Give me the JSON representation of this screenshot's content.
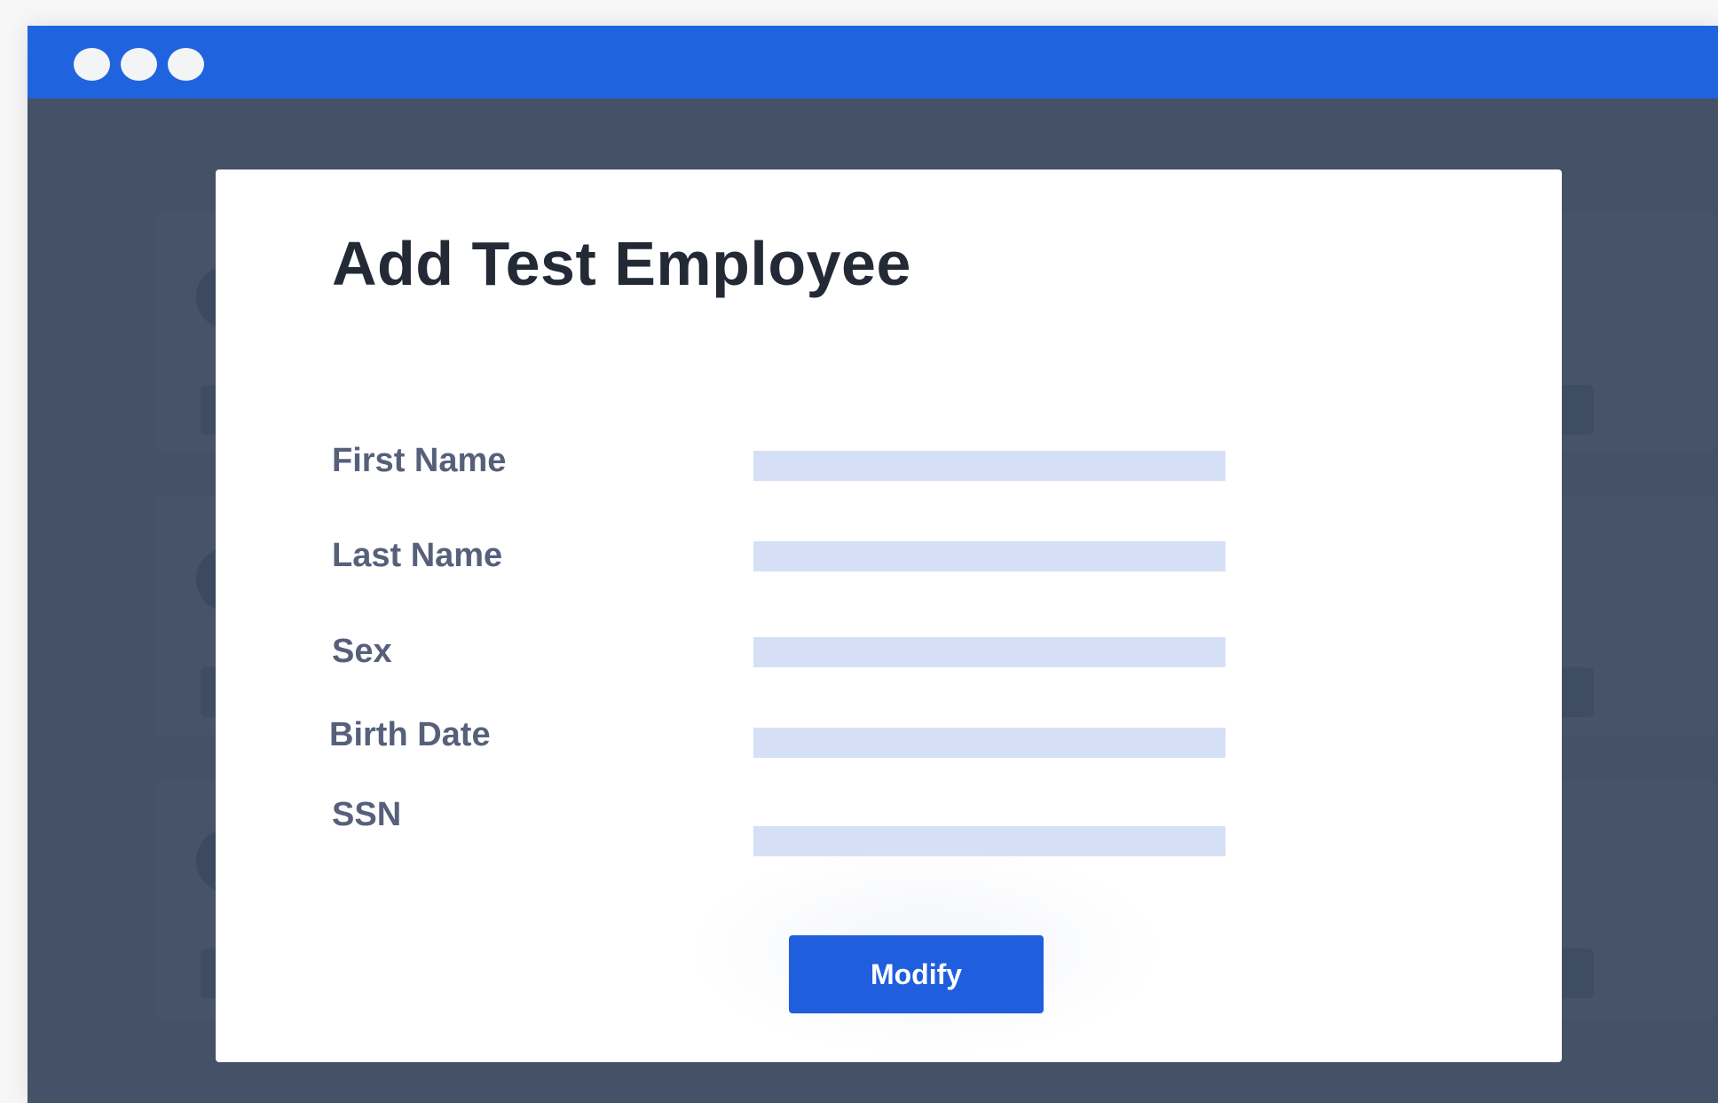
{
  "window": {
    "controls": [
      "window-dot-icon",
      "window-dot-icon",
      "window-dot-icon"
    ],
    "titlebar_color": "#2063de",
    "background_color": "#445166"
  },
  "modal": {
    "title": "Add Test Employee",
    "fields": [
      {
        "label": "First Name",
        "value": ""
      },
      {
        "label": "Last Name",
        "value": ""
      },
      {
        "label": "Sex",
        "value": ""
      },
      {
        "label": "Birth Date",
        "value": ""
      },
      {
        "label": "SSN",
        "value": ""
      }
    ],
    "submit_label": "Modify",
    "accent_color": "#1f5fde",
    "input_color": "#d5e0f7"
  }
}
